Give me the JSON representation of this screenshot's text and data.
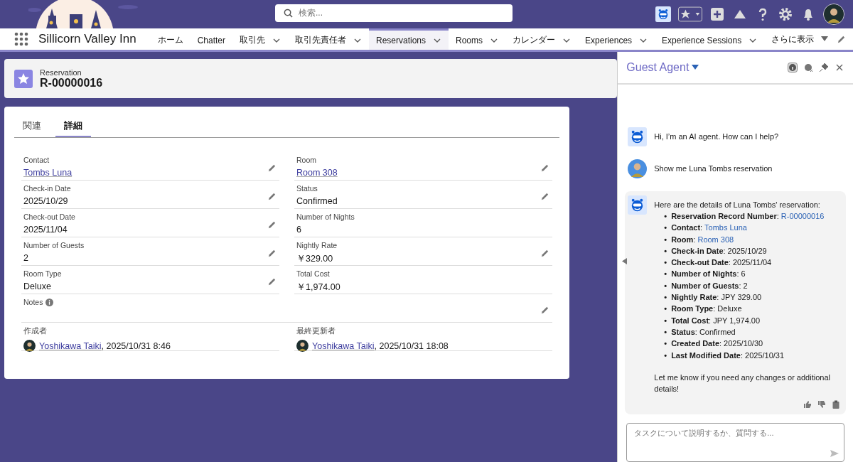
{
  "header": {
    "search_placeholder": "検索..."
  },
  "nav": {
    "app_name": "Sillicorn Valley Inn",
    "items": [
      {
        "label": "ホーム",
        "dropdown": false,
        "selected": false
      },
      {
        "label": "Chatter",
        "dropdown": false,
        "selected": false
      },
      {
        "label": "取引先",
        "dropdown": true,
        "selected": false
      },
      {
        "label": "取引先責任者",
        "dropdown": true,
        "selected": false
      },
      {
        "label": "Reservations",
        "dropdown": true,
        "selected": true
      },
      {
        "label": "Rooms",
        "dropdown": true,
        "selected": false
      },
      {
        "label": "カレンダー",
        "dropdown": true,
        "selected": false
      },
      {
        "label": "Experiences",
        "dropdown": true,
        "selected": false
      },
      {
        "label": "Experience Sessions",
        "dropdown": true,
        "selected": false
      }
    ],
    "more": "さらに表示"
  },
  "record": {
    "object_label": "Reservation",
    "title": "R-00000016"
  },
  "tabs": [
    {
      "label": "関連",
      "selected": false
    },
    {
      "label": "詳細",
      "selected": true
    }
  ],
  "fields": [
    {
      "kind": "link",
      "label": "Contact",
      "value": "Tombs Luna",
      "editable": true
    },
    {
      "kind": "link",
      "label": "Room",
      "value": "Room 308",
      "editable": true
    },
    {
      "kind": "text",
      "label": "Check-in Date",
      "value": "2025/10/29",
      "editable": true
    },
    {
      "kind": "text",
      "label": "Status",
      "value": "Confirmed",
      "editable": true
    },
    {
      "kind": "text",
      "label": "Check-out Date",
      "value": "2025/11/04",
      "editable": true
    },
    {
      "kind": "text",
      "label": "Number of Nights",
      "value": "6",
      "editable": false
    },
    {
      "kind": "text",
      "label": "Number of Guests",
      "value": "2",
      "editable": true
    },
    {
      "kind": "text",
      "label": "Nightly Rate",
      "value": "￥329.00",
      "editable": true
    },
    {
      "kind": "text",
      "label": "Room Type",
      "value": "Deluxe",
      "editable": true
    },
    {
      "kind": "text",
      "label": "Total Cost",
      "value": "￥1,974.00",
      "editable": false
    },
    {
      "kind": "notes",
      "label": "Notes",
      "editable": true
    },
    {
      "kind": "user",
      "label": "作成者",
      "user": "Yoshikawa Taiki",
      "value": ", 2025/10/31 8:46"
    },
    {
      "kind": "user",
      "label": "最終更新者",
      "user": "Yoshikawa Taiki",
      "value": ", 2025/10/31 18:08"
    }
  ],
  "chat": {
    "title": "Guest Agent",
    "messages": [
      {
        "kind": "agent",
        "text": "Hi, I’m an AI agent. How can I help?"
      },
      {
        "kind": "user",
        "text": "Show me Luna Tombs reservation"
      },
      {
        "kind": "agent",
        "text": "Here are the details of Luna Tombs' reservation:",
        "items": [
          {
            "bullet": "•",
            "text": "**Reservation Record Number**:",
            "link": "R-00000016"
          },
          {
            "bullet": "•",
            "text": "**Contact**:",
            "link": "Tombs Luna"
          },
          {
            "bullet": "•",
            "text": "**Room**:",
            "link": "Room 308"
          },
          {
            "bullet": "•",
            "text": "**Check-in Date**: 2025/10/29"
          },
          {
            "bullet": "•",
            "text": "**Check-out Date**: 2025/11/04"
          },
          {
            "bullet": "•",
            "text": "**Number of Nights**: 6"
          },
          {
            "bullet": "•",
            "text": "**Number of Guests**: 2"
          },
          {
            "bullet": "•",
            "text": "**Nightly Rate**: JPY 329.00"
          },
          {
            "bullet": "•",
            "text": "**Room Type**: Deluxe"
          },
          {
            "bullet": "•",
            "text": "**Total Cost**: JPY 1,974.00"
          },
          {
            "bullet": "•",
            "text": "**Status**: Confirmed"
          },
          {
            "bullet": "•",
            "text": "**Created Date**: 2025/10/30"
          },
          {
            "bullet": "•",
            "text": "**Last Modified Date**: 2025/10/31"
          }
        ],
        "outro": "Let me know if you need any changes or additional details!",
        "feedback": true
      }
    ],
    "input_placeholder": "タスクについて説明するか、質問する..."
  }
}
